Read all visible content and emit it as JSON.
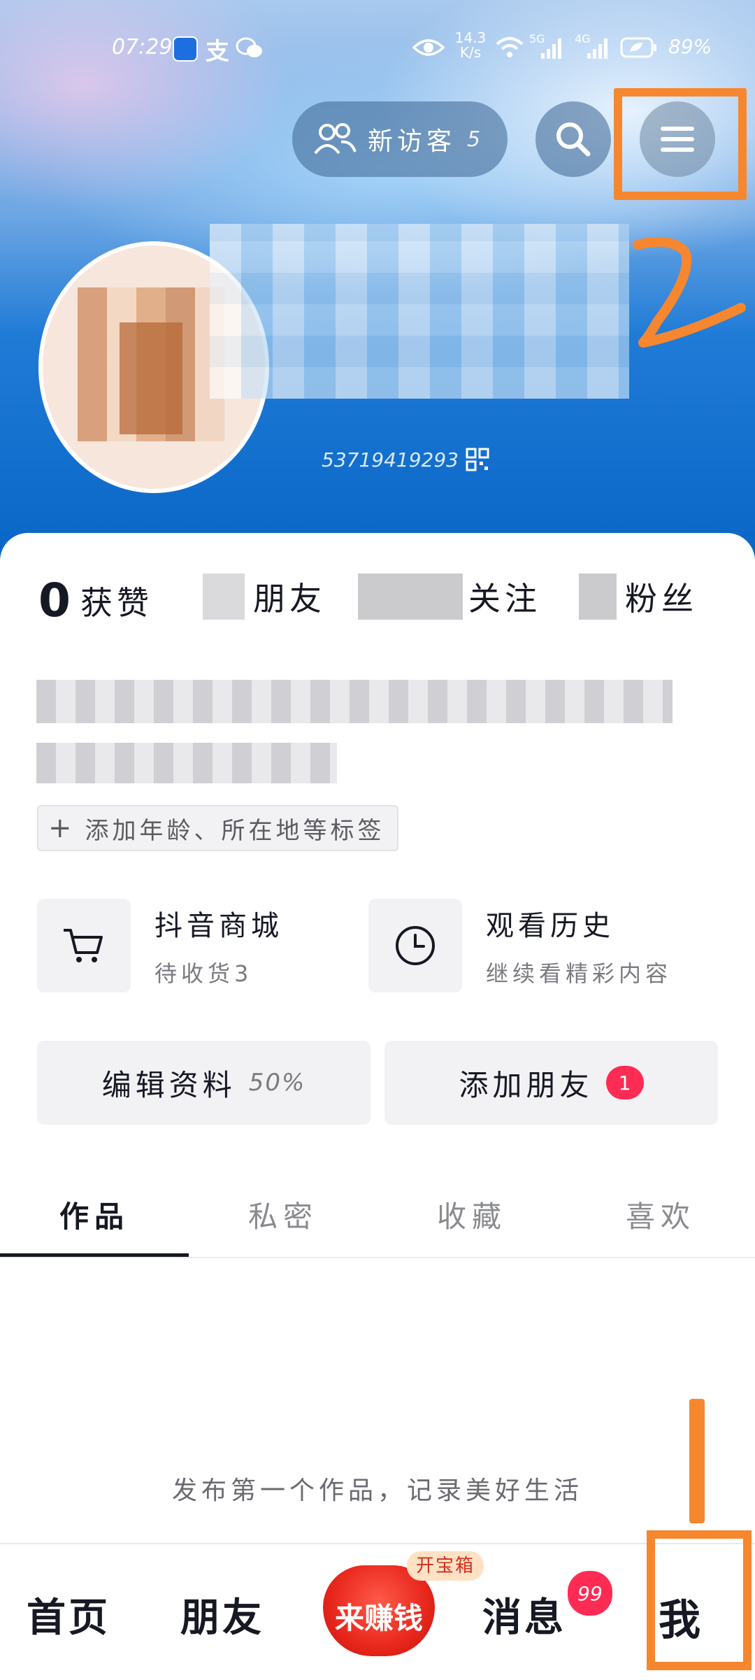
{
  "status_bar": {
    "time": "07:29",
    "net_speed": "14.3",
    "net_unit": "K/s",
    "sig1": "5G",
    "sig2": "4G",
    "battery": "89%"
  },
  "header": {
    "visitors_label": "新访客",
    "visitors_count": "5",
    "douyin_id_suffix": "53719419293"
  },
  "stats": [
    {
      "value": "0",
      "label": "获赞"
    },
    {
      "label": "朋友"
    },
    {
      "label": "关注"
    },
    {
      "label": "粉丝"
    }
  ],
  "add_tags": "添加年龄、所在地等标签",
  "shortcuts": [
    {
      "title": "抖音商城",
      "subtitle": "待收货3",
      "icon": "cart-icon"
    },
    {
      "title": "观看历史",
      "subtitle": "继续看精彩内容",
      "icon": "clock-icon"
    }
  ],
  "actions": {
    "edit_profile": "编辑资料",
    "edit_progress": "50%",
    "add_friend": "添加朋友",
    "add_friend_badge": "1"
  },
  "tabs": [
    "作品",
    "私密",
    "收藏",
    "喜欢"
  ],
  "empty_hint": "发布第一个作品，记录美好生活",
  "bottom_nav": {
    "home": "首页",
    "friends": "朋友",
    "earn": "来赚钱",
    "earn_tag": "开宝箱",
    "messages": "消息",
    "messages_badge": "99",
    "me": "我"
  },
  "colors": {
    "accent_red": "#fe2c55",
    "annotation_orange": "#f6872e",
    "header_blue": "#0a66c6"
  }
}
